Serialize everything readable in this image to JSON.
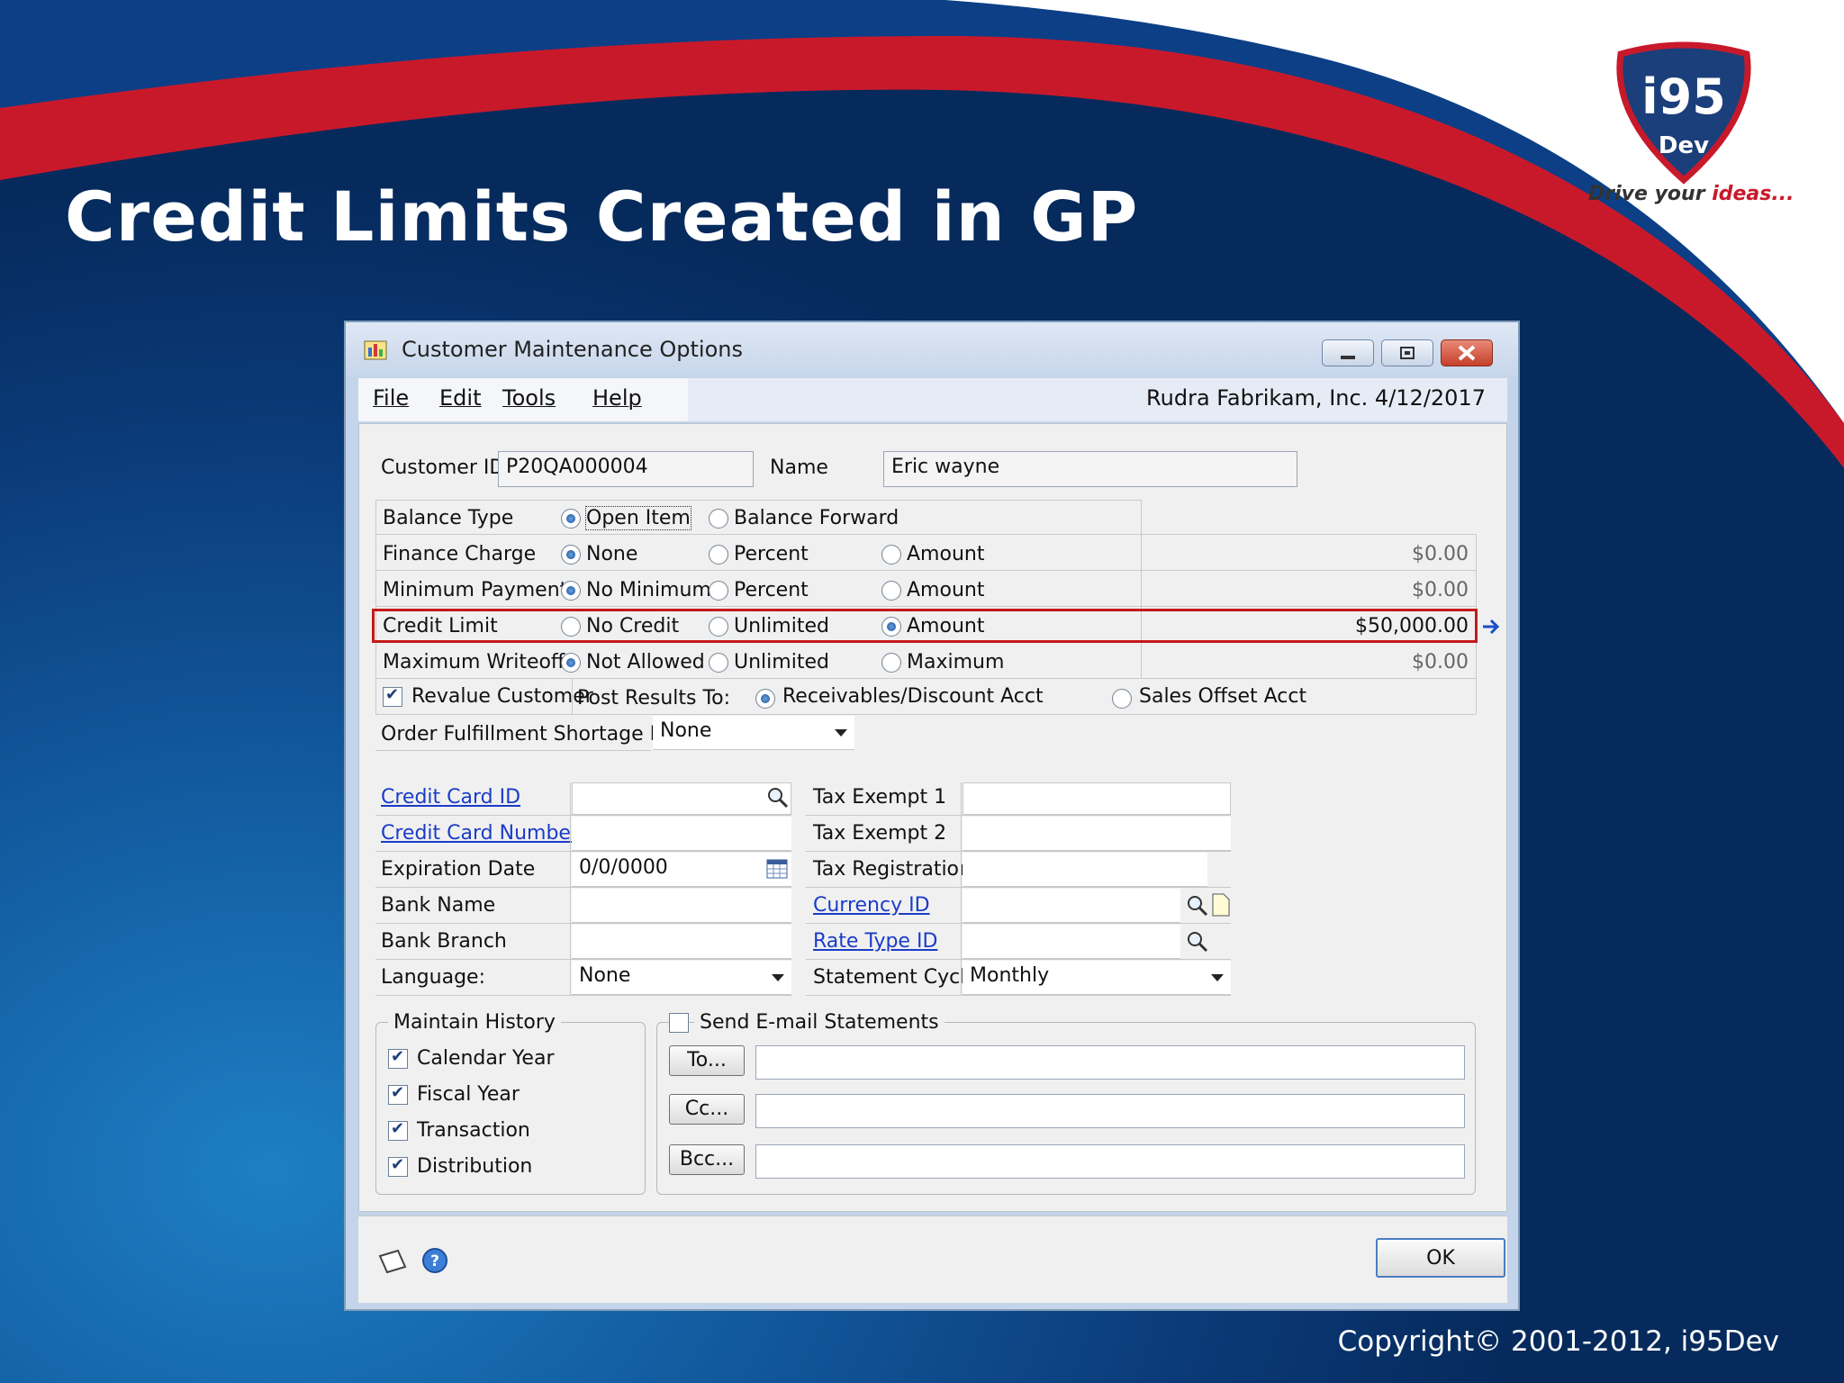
{
  "slide": {
    "title": "Credit Limits Created in GP",
    "copyright": "Copyright©  2001-2012, i95Dev",
    "logo": {
      "main": "i95",
      "sub": "Dev",
      "tagline_a": "Drive your ",
      "tagline_b": "ideas..."
    }
  },
  "window": {
    "title": "Customer Maintenance Options",
    "menu": [
      "File",
      "Edit",
      "Tools",
      "Help"
    ],
    "status": "Rudra  Fabrikam, Inc.  4/12/2017"
  },
  "form": {
    "customer_id_label": "Customer ID",
    "customer_id": "P20QA000004",
    "name_label": "Name",
    "name": "Eric wayne",
    "balance_type": {
      "label": "Balance Type",
      "options": [
        "Open Item",
        "Balance Forward"
      ],
      "selected": "Open Item"
    },
    "finance_charge": {
      "label": "Finance Charge",
      "options": [
        "None",
        "Percent",
        "Amount"
      ],
      "selected": "None",
      "value": "$0.00"
    },
    "minimum_payment": {
      "label": "Minimum Payment",
      "options": [
        "No Minimum",
        "Percent",
        "Amount"
      ],
      "selected": "No Minimum",
      "value": "$0.00"
    },
    "credit_limit": {
      "label": "Credit Limit",
      "options": [
        "No Credit",
        "Unlimited",
        "Amount"
      ],
      "selected": "Amount",
      "value": "$50,000.00"
    },
    "maximum_writeoff": {
      "label": "Maximum Writeoff",
      "options": [
        "Not Allowed",
        "Unlimited",
        "Maximum"
      ],
      "selected": "Not Allowed",
      "value": "$0.00"
    },
    "revalue_customer": {
      "label": "Revalue Customer",
      "checked": true
    },
    "post_results": {
      "label": "Post Results To:",
      "options": [
        "Receivables/Discount Acct",
        "Sales Offset Acct"
      ],
      "selected": "Receivables/Discount Acct"
    },
    "order_fulfillment": {
      "label": "Order Fulfillment Shortage Default",
      "value": "None"
    },
    "credit_card_id_label": "Credit Card ID",
    "credit_card_number_label": "Credit Card Number",
    "expiration_date_label": "Expiration Date",
    "expiration_date": "0/0/0000",
    "bank_name_label": "Bank Name",
    "bank_branch_label": "Bank Branch",
    "language_label": "Language:",
    "language": "None",
    "tax_exempt_1_label": "Tax Exempt 1",
    "tax_exempt_2_label": "Tax Exempt 2",
    "tax_registration_label": "Tax Registration",
    "currency_id_label": "Currency ID",
    "rate_type_id_label": "Rate Type ID",
    "statement_cycle_label": "Statement Cycle",
    "statement_cycle": "Monthly",
    "maintain_history": {
      "label": "Maintain History",
      "items": [
        {
          "label": "Calendar Year",
          "checked": true
        },
        {
          "label": "Fiscal Year",
          "checked": true
        },
        {
          "label": "Transaction",
          "checked": true
        },
        {
          "label": "Distribution",
          "checked": true
        }
      ]
    },
    "email_statements": {
      "label": "Send E-mail Statements",
      "checked": false,
      "to": "To...",
      "cc": "Cc...",
      "bcc": "Bcc..."
    },
    "ok": "OK"
  },
  "colors": {
    "highlight": "#c41a1a",
    "link": "#1a3cc8",
    "bg_dark": "#0b3a78"
  }
}
